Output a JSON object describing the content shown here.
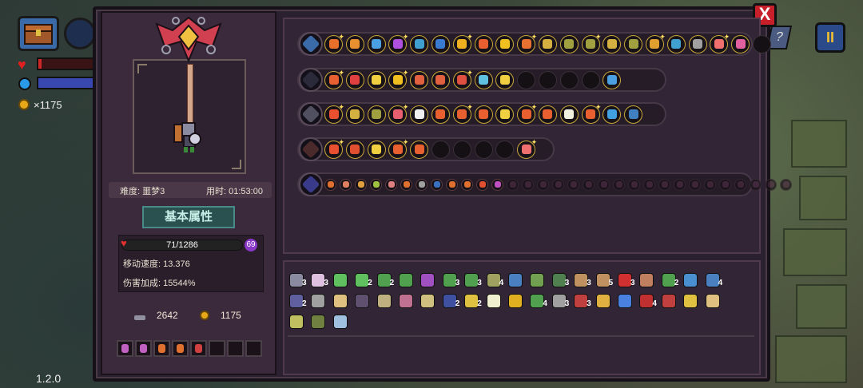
{
  "hud": {
    "coin_count": "×1175",
    "version": "1.2.0",
    "pause_label": "II",
    "help_label": "?",
    "hp_fraction": 0.06
  },
  "dialog": {
    "close_label": "X"
  },
  "character": {
    "difficulty_label": "难度: 噩梦3",
    "time_label": "用时: 01:53:00",
    "section_title": "基本属性",
    "hp_text": "71/1286",
    "shield_value": "69",
    "move_speed": "移动速度: 13.376",
    "damage_bonus": "伤害加成: 15544%",
    "keys": "2642",
    "gold": "1175",
    "quick_slots": [
      {
        "icon": "potion-icon",
        "color": "#c060c0"
      },
      {
        "icon": "potion-icon",
        "color": "#c060c0"
      },
      {
        "icon": "bomb-icon",
        "color": "#e07030"
      },
      {
        "icon": "bomb-icon",
        "color": "#e07030"
      },
      {
        "icon": "bomb-icon",
        "color": "#d04040"
      },
      {
        "icon": "empty",
        "color": ""
      },
      {
        "icon": "empty",
        "color": ""
      },
      {
        "icon": "empty",
        "color": ""
      }
    ]
  },
  "build_rows": [
    {
      "name": "row-chest",
      "main_icon": "chest-icon",
      "slots": [
        "#e8702a",
        "#e89030",
        "#4aa0e0",
        "#b050e0",
        "#40a0d0",
        "#3a7ad0",
        "#f0b020",
        "#e86030",
        "#f0c020",
        "#e87030",
        "#d4b040",
        "#a0a040",
        "#a0a040",
        "#d4b040",
        "#a0a040",
        "#e0a030",
        "#40a0d0",
        "#a0a0a0",
        "#f07070",
        "#e060a0",
        ""
      ]
    },
    {
      "name": "row-staff",
      "main_icon": "staff-icon",
      "slots": [
        "#e86030",
        "#e04040",
        "#f0d040",
        "#f0c020",
        "#e06040",
        "#e06040",
        "#e05040",
        "#60c0e0",
        "#f0d040",
        "",
        "",
        "",
        "",
        "#4aa0e0"
      ]
    },
    {
      "name": "row-cannon",
      "main_icon": "cannon-icon",
      "slots": [
        "#e85030",
        "#d4b040",
        "#a0a040",
        "#e86070",
        "#f0f0f0",
        "#e86030",
        "#e86030",
        "#e86030",
        "#f0d040",
        "#e86030",
        "#e86030",
        "#f0f0e0",
        "#e86030",
        "#40a0e0",
        "#4080c0"
      ]
    },
    {
      "name": "row-axe",
      "main_icon": "axe-icon",
      "slots": [
        "#e85030",
        "#e05030",
        "#f0d040",
        "#e86030",
        "#e86030",
        "",
        "",
        "",
        "",
        "#f07070"
      ]
    },
    {
      "name": "row-orb",
      "main_icon": "orb-icon",
      "small_slots": [
        "#e07030",
        "#e08060",
        "#e0a040",
        "#a0c040",
        "#e08080",
        "#e07030",
        "#a0a0a0",
        "#3a70c0",
        "#e07030",
        "#e07030",
        "#e05030",
        "#c050c0",
        "",
        "",
        "",
        "",
        "",
        "",
        "",
        "",
        "",
        "",
        "",
        "",
        "",
        "",
        "",
        "",
        "",
        "",
        ""
      ]
    }
  ],
  "inventory": [
    {
      "color": "#8a8aa0",
      "count": "3"
    },
    {
      "color": "#e0c0e0",
      "count": "3"
    },
    {
      "color": "#60c060",
      "count": ""
    },
    {
      "color": "#60c060",
      "count": "2"
    },
    {
      "color": "#50a050",
      "count": "2"
    },
    {
      "color": "#50a050",
      "count": ""
    },
    {
      "color": "#a050c0",
      "count": ""
    },
    {
      "color": "#50a050",
      "count": "3"
    },
    {
      "color": "#50a050",
      "count": "3"
    },
    {
      "color": "#a0a060",
      "count": "4"
    },
    {
      "color": "#4a80c0",
      "count": ""
    },
    {
      "color": "#70a050",
      "count": ""
    },
    {
      "color": "#508050",
      "count": "3"
    },
    {
      "color": "#c09060",
      "count": "3"
    },
    {
      "color": "#c09060",
      "count": "5"
    },
    {
      "color": "#d03030",
      "count": "3"
    },
    {
      "color": "#c08060",
      "count": ""
    },
    {
      "color": "#50a050",
      "count": "2"
    },
    {
      "color": "#4a90d0",
      "count": ""
    },
    {
      "color": "#4a80c0",
      "count": "4"
    },
    {
      "color": "#6060a0",
      "count": "2"
    },
    {
      "color": "#a0a0a0",
      "count": ""
    },
    {
      "color": "#e0c080",
      "count": ""
    },
    {
      "color": "#605070",
      "count": ""
    },
    {
      "color": "#c0b080",
      "count": ""
    },
    {
      "color": "#c07090",
      "count": ""
    },
    {
      "color": "#d0c080",
      "count": ""
    },
    {
      "color": "#4050a0",
      "count": "2"
    },
    {
      "color": "#e0c040",
      "count": "2"
    },
    {
      "color": "#f0f0d0",
      "count": ""
    },
    {
      "color": "#e0b020",
      "count": ""
    },
    {
      "color": "#50a050",
      "count": "4"
    },
    {
      "color": "#a0a0a0",
      "count": "3"
    },
    {
      "color": "#c04040",
      "count": "3"
    },
    {
      "color": "#e0b040",
      "count": ""
    },
    {
      "color": "#4a80e0",
      "count": ""
    },
    {
      "color": "#c03030",
      "count": "4"
    },
    {
      "color": "#c04040",
      "count": ""
    },
    {
      "color": "#e0c040",
      "count": ""
    },
    {
      "color": "#e0c080",
      "count": ""
    },
    {
      "color": "#c0c060",
      "count": ""
    },
    {
      "color": "#708040",
      "count": ""
    },
    {
      "color": "#a0c0e0",
      "count": ""
    }
  ]
}
